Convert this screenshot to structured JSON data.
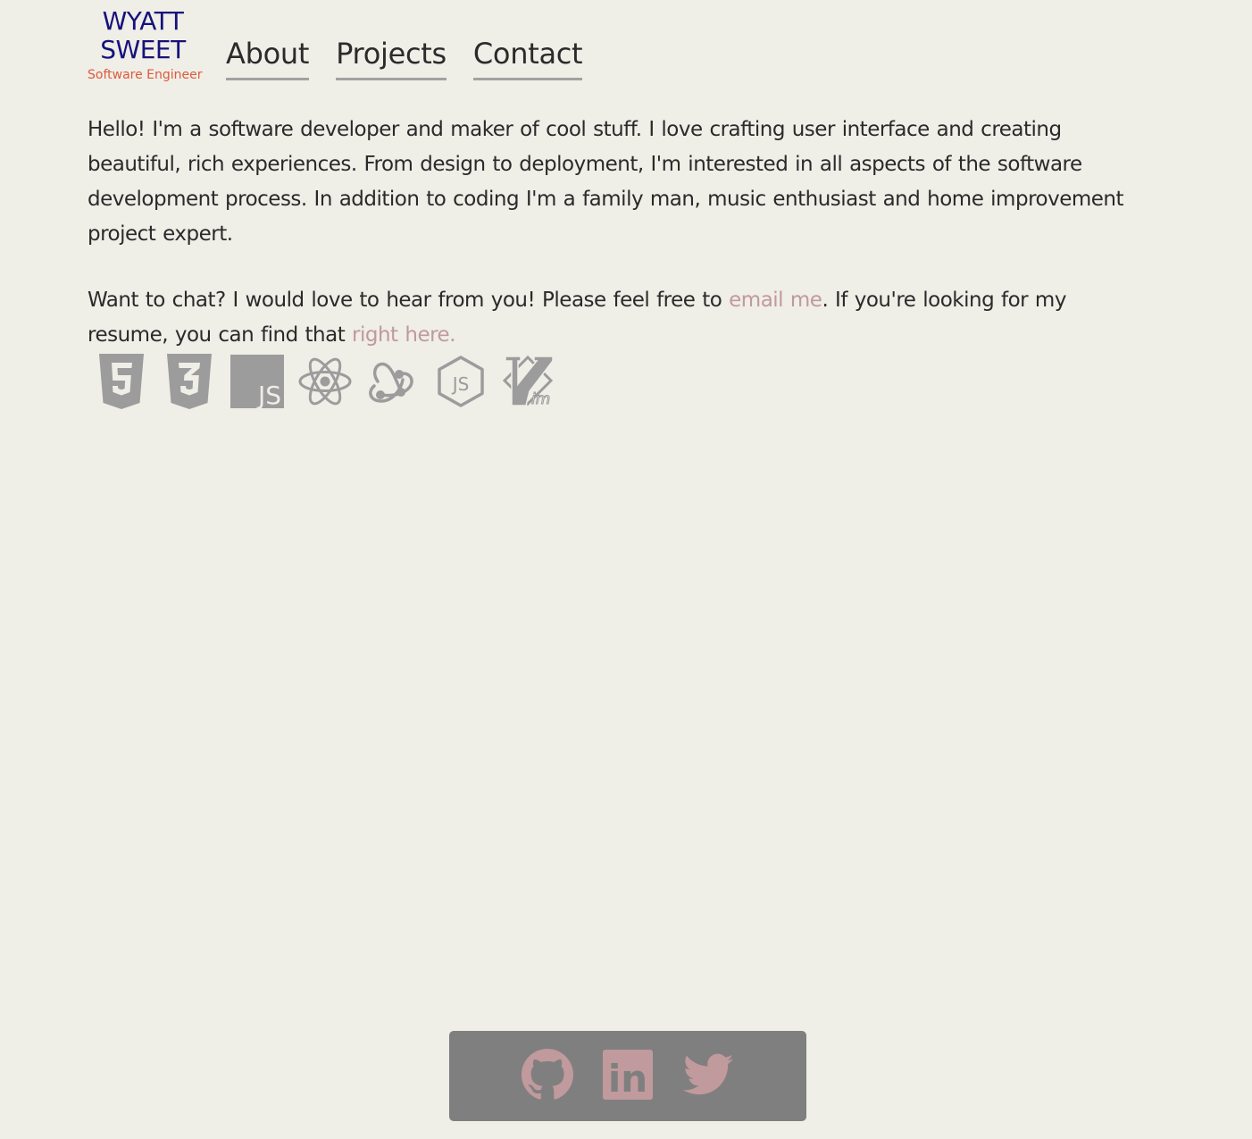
{
  "logo": {
    "line1": "WYATT",
    "line2": "SWEET",
    "subtitle": "Software Engineer",
    "name_color": "#16127a",
    "subtitle_color": "#dd5a3c"
  },
  "nav": {
    "items": [
      {
        "label": "About"
      },
      {
        "label": "Projects"
      },
      {
        "label": "Contact"
      }
    ]
  },
  "intro": {
    "text": "Hello! I'm a software developer and maker of cool stuff. I love crafting user interface and creating beautiful, rich experiences. From design to deployment, I'm interested in all aspects of the software development process. In addition to coding I'm a family man, music enthusiast and home improvement project expert."
  },
  "contact": {
    "text_before": "Want to chat? I would love to hear from you! Please feel free to ",
    "email_link": "email me",
    "text_middle": ". If you're looking for my resume, you can find that ",
    "resume_link": "right here.",
    "link_color": "#c09a9c"
  },
  "tech_icons": [
    {
      "icon": "html5-icon"
    },
    {
      "icon": "css3-icon"
    },
    {
      "icon": "javascript-icon",
      "label": "JS"
    },
    {
      "icon": "react-icon"
    },
    {
      "icon": "redux-icon"
    },
    {
      "icon": "nodejs-icon",
      "label": "JS"
    },
    {
      "icon": "vim-icon",
      "label": "im"
    }
  ],
  "social": {
    "items": [
      {
        "icon": "github-icon"
      },
      {
        "icon": "linkedin-icon",
        "label": "in"
      },
      {
        "icon": "twitter-icon"
      }
    ],
    "bar_color": "#807f7f",
    "icon_color": "#c09a9c"
  },
  "colors": {
    "background": "#efeee7",
    "text": "#2a2a2a",
    "icon_gray": "#9d9c9c",
    "nav_underline": "#a3a1a1"
  }
}
